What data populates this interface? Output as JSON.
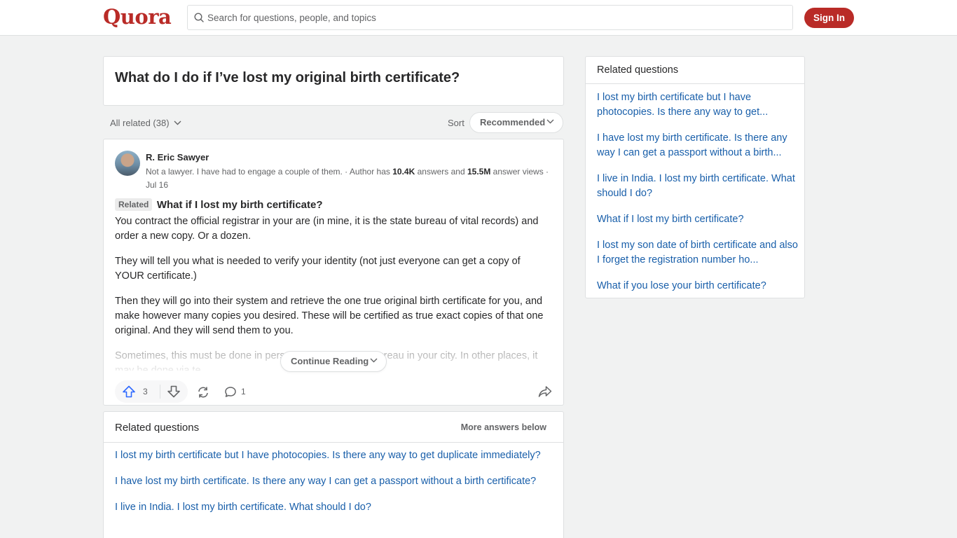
{
  "header": {
    "logo": "Quora",
    "search_placeholder": "Search for questions, people, and topics",
    "signin_label": "Sign In"
  },
  "question": {
    "title": "What do I do if I’ve lost my original birth certificate?"
  },
  "filters": {
    "all_related": "All related (38)",
    "sort_label": "Sort",
    "sort_value": "Recommended"
  },
  "answer": {
    "author": "R. Eric Sawyer",
    "credential_text": "Not a lawyer. I have had to engage a couple of them. · Author has ",
    "answers_count": "10.4K",
    "answers_label": " answers and ",
    "views_count": "15.5M",
    "views_label": " answer views · Jul 16",
    "related_tag": "Related",
    "related_question": "What if I lost my birth certificate?",
    "paragraphs": [
      "You contract the official registrar in your are (in mine, it is the state bureau of vital records) and order a new copy. Or a dozen.",
      "They will tell you what is needed to verify your identity (not just everyone can get a copy of YOUR certificate.)",
      "Then they will go into their system and retrieve the one true original birth certificate for you, and make however many copies you desired. These will be certified as true exact copies of that one original. And they will send them to you.",
      "Sometimes, this must be done in person at a branch of a bureau in your city. In other places, it may be done via te"
    ],
    "continue_label": "Continue Reading",
    "upvotes": "3",
    "comments": "1"
  },
  "related_main": {
    "title": "Related questions",
    "more_label": "More answers below",
    "items": [
      "I lost my birth certificate but I have photocopies. Is there any way to get duplicate immediately?",
      "I have lost my birth certificate. Is there any way I can get a passport without a birth certificate?",
      "I live in India. I lost my birth certificate. What should I do?"
    ]
  },
  "sidebar": {
    "title": "Related questions",
    "items": [
      "I lost my birth certificate but I have photocopies. Is there any way to get...",
      "I have lost my birth certificate. Is there any way I can get a passport without a birth...",
      "I live in India. I lost my birth certificate. What should I do?",
      "What if I lost my birth certificate?",
      "I lost my son date of birth certificate and also I forget the registration number ho...",
      "What if you lose your birth certificate?"
    ]
  },
  "colors": {
    "brand": "#b92b27",
    "link": "#195faa",
    "upvote": "#2e69ff"
  }
}
